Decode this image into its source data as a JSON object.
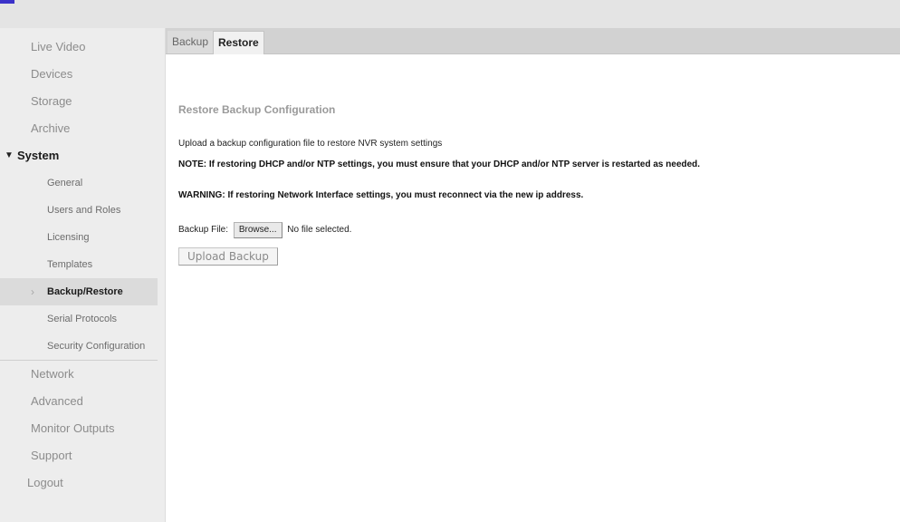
{
  "sidebar": {
    "items_top": [
      "Live Video",
      "Devices",
      "Storage",
      "Archive"
    ],
    "group_label": "System",
    "sub_items": [
      "General",
      "Users and Roles",
      "Licensing",
      "Templates",
      "Backup/Restore",
      "Serial Protocols",
      "Security Configuration"
    ],
    "items_bottom": [
      "Network",
      "Advanced",
      "Monitor Outputs",
      "Support"
    ],
    "logout": "Logout"
  },
  "tabs": [
    "Backup",
    "Restore"
  ],
  "restore": {
    "heading": "Restore Backup Configuration",
    "description": "Upload a backup configuration file to restore NVR system settings",
    "note": "NOTE: If restoring DHCP and/or NTP settings, you must ensure that your DHCP and/or NTP server is restarted as needed.",
    "warning": "WARNING: If restoring Network Interface settings, you must reconnect via the new ip address.",
    "file_label": "Backup File:",
    "browse_label": "Browse...",
    "file_status": "No file selected.",
    "upload_label": "Upload Backup"
  }
}
